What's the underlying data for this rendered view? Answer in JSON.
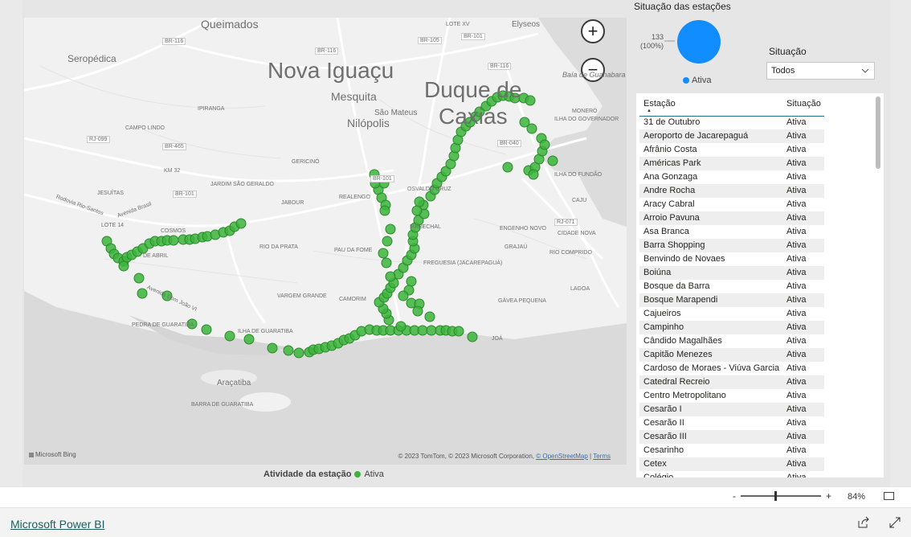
{
  "map": {
    "city_labels": [
      {
        "text": "Queimados",
        "size": 14
      },
      {
        "text": "Elyseos",
        "size": 10
      },
      {
        "text": "Seropédica",
        "size": 12
      },
      {
        "text": "Nova Iguaçu",
        "size": 28
      },
      {
        "text": "Duque de",
        "size": 28
      },
      {
        "text": "Caxias",
        "size": 28
      },
      {
        "text": "Mesquita",
        "size": 14
      },
      {
        "text": "São Mateus",
        "size": 10
      },
      {
        "text": "Nilópolis",
        "size": 14
      },
      {
        "text": "Araçatiba",
        "size": 10
      }
    ],
    "small_labels": [
      "IPIRANGA",
      "CAMPO LINDO",
      "KM 32",
      "JESUÍTAS",
      "JARDIM SÃO GERALDO",
      "GERICINÓ",
      "REALENGO",
      "JABOUR",
      "OSVALDO CRUZ",
      "MARECHAL",
      "ENGENHO NOVO",
      "GRAJAÚ",
      "RIO COMPRIDO",
      "CIDADE NOVA",
      "CAJU",
      "ILHA DO FUNDÃO",
      "ILHA DO GOVERNADOR",
      "MONERÓ",
      "COSMOS",
      "LOTE 14",
      "RIO DA PRATA",
      "PAU DA FOME",
      "FREGUESIA (JACAREPAGUÁ)",
      "VARGEM GRANDE",
      "CAMORIM",
      "GÁVEA PEQUENA",
      "LAGOA",
      "JOÁ",
      "PEDRA DE GUARATIBA",
      "ILHA DE GUARATIBA",
      "BARRA DE GUARATIBA",
      "DE ABRIL",
      "Baía de Guanabara"
    ],
    "road_labels": [
      "BR-116",
      "BR-116",
      "BR-105",
      "BR-101",
      "BR-116",
      "LOTE XV",
      "RJ-099",
      "BR-465",
      "BR-101",
      "BR-101",
      "BR-040",
      "RJ-071",
      "Rodovia Rio-Santos",
      "Avenida Brasil",
      "Avenida Dom João VI"
    ],
    "zoom_in": "+",
    "zoom_out": "−",
    "bing_label": "Microsoft Bing",
    "attribution_prefix": "© 2023 TomTom, © 2023 Microsoft Corporation,",
    "attribution_osm": "© OpenStreetMap",
    "attribution_terms": "Terms",
    "marker_color": "#3cb43c",
    "stations_shown": 133
  },
  "legend_bottom": {
    "title": "Atividade da estação",
    "item": "Ativa",
    "color": "#3cb43c"
  },
  "pie": {
    "title": "Situação das estações",
    "value_label": "133",
    "pct_label": "(100%)",
    "legend_item": "Ativa",
    "color": "#118dff",
    "chart_data": {
      "type": "pie",
      "categories": [
        "Ativa"
      ],
      "values": [
        133
      ],
      "title": "Situação das estações"
    }
  },
  "slicer": {
    "title": "Situação",
    "value": "Todos"
  },
  "table": {
    "col1": "Estação",
    "col2": "Situação",
    "rows": [
      [
        "31 de Outubro",
        "Ativa"
      ],
      [
        "Aeroporto de Jacarepaguá",
        "Ativa"
      ],
      [
        "Afrânio Costa",
        "Ativa"
      ],
      [
        "Américas Park",
        "Ativa"
      ],
      [
        "Ana Gonzaga",
        "Ativa"
      ],
      [
        "Andre Rocha",
        "Ativa"
      ],
      [
        "Aracy Cabral",
        "Ativa"
      ],
      [
        "Arroio Pavuna",
        "Ativa"
      ],
      [
        "Asa Branca",
        "Ativa"
      ],
      [
        "Barra Shopping",
        "Ativa"
      ],
      [
        "Benvindo de Novaes",
        "Ativa"
      ],
      [
        "Boiúna",
        "Ativa"
      ],
      [
        "Bosque da Barra",
        "Ativa"
      ],
      [
        "Bosque Marapendi",
        "Ativa"
      ],
      [
        "Cajueiros",
        "Ativa"
      ],
      [
        "Campinho",
        "Ativa"
      ],
      [
        "Cândido Magalhães",
        "Ativa"
      ],
      [
        "Capitão Menezes",
        "Ativa"
      ],
      [
        "Cardoso de Moraes - Viúva Garcia",
        "Ativa"
      ],
      [
        "Catedral Recreio",
        "Ativa"
      ],
      [
        "Centro Metropolitano",
        "Ativa"
      ],
      [
        "Cesarão I",
        "Ativa"
      ],
      [
        "Cesarão II",
        "Ativa"
      ],
      [
        "Cesarão III",
        "Ativa"
      ],
      [
        "Cesarinho",
        "Ativa"
      ],
      [
        "Cetex",
        "Ativa"
      ],
      [
        "Colégio",
        "Ativa"
      ]
    ]
  },
  "zoom": {
    "minus": "-",
    "plus": "+",
    "percent": "84%",
    "level": 0.42
  },
  "footer": {
    "brand": "Microsoft Power BI"
  }
}
